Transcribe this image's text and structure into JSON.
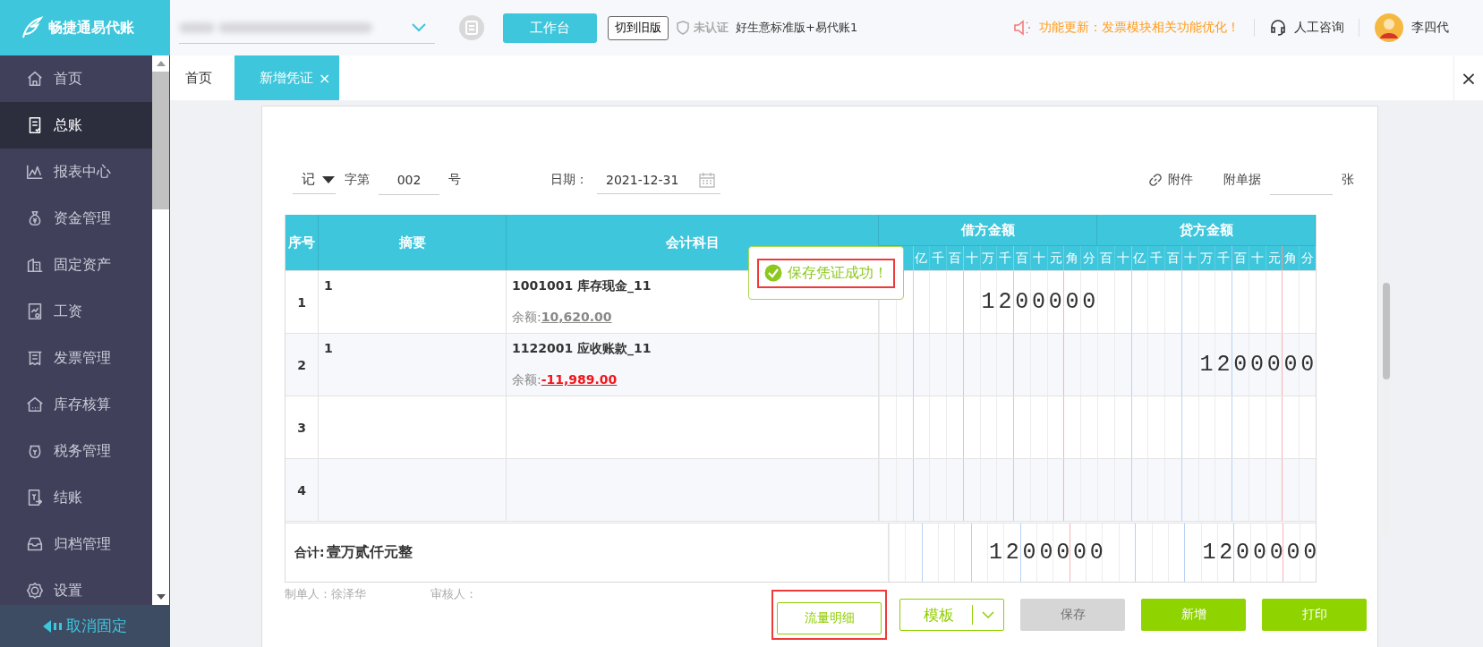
{
  "header": {
    "logo": "畅捷通易代账",
    "workbench_button": "工作台",
    "old_version_button": "切到旧版",
    "cert_status": "未认证",
    "edition": "好生意标准版+易代账1",
    "notice": "功能更新：发票模块相关功能优化！",
    "support": "人工咨询",
    "user": "李四代"
  },
  "sidebar": {
    "items": [
      {
        "label": "首页",
        "selected": false
      },
      {
        "label": "总账",
        "selected": true
      },
      {
        "label": "报表中心",
        "selected": false
      },
      {
        "label": "资金管理",
        "selected": false
      },
      {
        "label": "固定资产",
        "selected": false
      },
      {
        "label": "工资",
        "selected": false
      },
      {
        "label": "发票管理",
        "selected": false
      },
      {
        "label": "库存核算",
        "selected": false
      },
      {
        "label": "税务管理",
        "selected": false
      },
      {
        "label": "结账",
        "selected": false
      },
      {
        "label": "归档管理",
        "selected": false
      },
      {
        "label": "设置",
        "selected": false
      }
    ],
    "unpin": "取消固定"
  },
  "tabs": [
    {
      "label": "首页",
      "selected": false
    },
    {
      "label": "新增凭证",
      "selected": true,
      "close": "×"
    }
  ],
  "page_close": "×",
  "voucher": {
    "word": "记",
    "word_suffix": "字第",
    "number": "002",
    "number_suffix": "号",
    "date_label": "日期：",
    "date": "2021-12-31",
    "attachment_link": "附件",
    "attached_label": "附单据",
    "attached_suffix": "张"
  },
  "table": {
    "columns": [
      "序号",
      "摘要",
      "会计科目"
    ],
    "debit_header": "借方金额",
    "credit_header": "贷方金额",
    "debit_units": [
      "亿",
      "千",
      "百",
      "十",
      "万",
      "千",
      "百",
      "十",
      "元",
      "角",
      "分"
    ],
    "credit_units": [
      "百",
      "十",
      "亿",
      "千",
      "百",
      "十",
      "万",
      "千",
      "百",
      "十",
      "元",
      "角",
      "分"
    ],
    "rows": [
      {
        "no": "1",
        "summary": "1",
        "account": "1001001 库存现金_11",
        "balance_label": "余额:",
        "balance": "10,620.00",
        "negative": false,
        "debit": "1200000"
      },
      {
        "no": "2",
        "summary": "1",
        "account": "1122001 应收账款_11",
        "balance_label": "余额:",
        "balance": "-11,989.00",
        "negative": true,
        "credit": "1200000"
      },
      {
        "no": "3"
      },
      {
        "no": "4"
      }
    ],
    "total": {
      "label": "合计:",
      "amount_words": "壹万贰仟元整",
      "debit": "1200000",
      "credit": "1200000"
    }
  },
  "toast": {
    "text": "保存凭证成功！",
    "highlighted": true
  },
  "footer": {
    "maker": "制单人：徐泽华",
    "reviewer": "审核人：",
    "buttons": [
      {
        "label": "流量明细",
        "kind": "outline",
        "highlighted": true
      },
      {
        "label": "模板",
        "kind": "split",
        "highlighted": false
      },
      {
        "label": "保存",
        "kind": "primary",
        "disabled": true,
        "highlighted": false
      },
      {
        "label": "新增",
        "kind": "primary",
        "disabled": false,
        "highlighted": false
      },
      {
        "label": "打印",
        "kind": "primary",
        "disabled": false,
        "highlighted": false
      }
    ]
  }
}
